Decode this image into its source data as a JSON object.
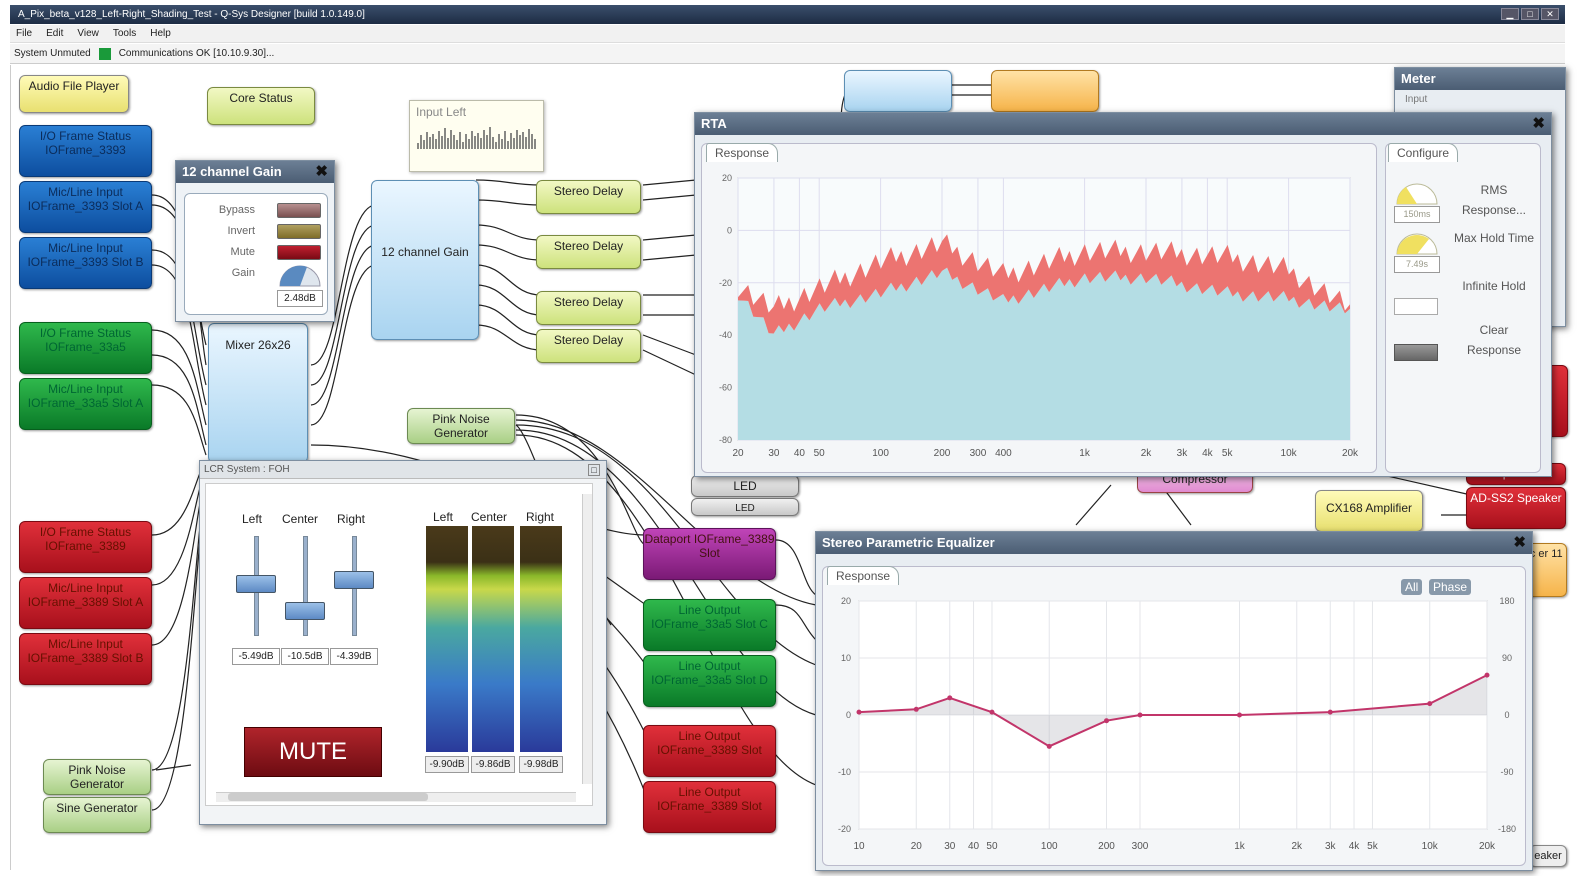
{
  "window": {
    "title": "A_Pix_beta_v128_Left-Right_Shading_Test - Q-Sys Designer [build 1.0.149.0]"
  },
  "menu": [
    "File",
    "Edit",
    "View",
    "Tools",
    "Help"
  ],
  "status": {
    "system": "System Unmuted",
    "comms": "Communications OK [10.10.9.30]..."
  },
  "colors": {
    "comms_ok": "#1a9a3a",
    "rta_red": "#ec7471",
    "rta_blue": "#b4dde4",
    "mute": "#9a1a22"
  },
  "blocks": {
    "audio_file_player": "Audio File Player",
    "core_status": "Core Status",
    "io_frame_status_blue": "I/O Frame Status IOFrame_3393",
    "mic_in_blue_a": "Mic/Line Input IOFrame_3393 Slot A",
    "mic_in_blue_b": "Mic/Line Input IOFrame_3393 Slot B",
    "io_frame_status_green": "I/O Frame Status IOFrame_33a5",
    "mic_in_green_a": "Mic/Line Input IOFrame_33a5 Slot A",
    "io_frame_status_red": "I/O Frame Status IOFrame_3389",
    "mic_in_red_a": "Mic/Line Input IOFrame_3389 Slot A",
    "mic_in_red_b": "Mic/Line Input IOFrame_3389 Slot B",
    "pink_noise_1": "Pink Noise Generator",
    "pink_noise_2": "Pink Noise Generator",
    "sine_gen": "Sine Generator",
    "mixer": "Mixer 26x26",
    "gain12": "12 channel Gain",
    "stereo_delay": "Stereo Delay",
    "dataport": "Dataport IOFrame_3389 Slot",
    "line_out_green_c": "Line Output IOFrame_33a5 Slot C",
    "line_out_green_d": "Line Output IOFrame_33a5 Slot D",
    "line_out_red_a": "Line Output IOFrame_3389 Slot",
    "line_out_red_b": "Line Output IOFrame_3389 Slot",
    "led": "LED",
    "compressor": "Compressor",
    "cx168": "CX168 Amplifier",
    "ad_ss2": "AD-SS2 Speaker",
    "speaker": "Speaker",
    "edge_fragment": "ic er 11",
    "edge_speaker": "eaker"
  },
  "input_left": {
    "title": "Input Left"
  },
  "gain_panel": {
    "title": "12 channel Gain",
    "bypass": "Bypass",
    "invert": "Invert",
    "mute": "Mute",
    "gain": "Gain",
    "gain_value": "2.48dB"
  },
  "rta": {
    "title": "RTA",
    "response_tab": "Response",
    "configure_tab": "Configure",
    "yticks": [
      "20",
      "0",
      "-20",
      "-40",
      "-60",
      "-80"
    ],
    "xticks": [
      "20",
      "30",
      "40",
      "50",
      "100",
      "200",
      "300",
      "400",
      "1k",
      "2k",
      "3k",
      "4k",
      "5k",
      "10k",
      "20k"
    ],
    "config": {
      "rms_value": "150ms",
      "rms_label": "RMS Response...",
      "hold_value": "7.49s",
      "hold_label": "Max Hold Time",
      "infinite": "Infinite Hold",
      "clear": "Clear Response"
    }
  },
  "meter": {
    "title": "Meter",
    "input": "Input"
  },
  "lcr": {
    "title": "LCR System : FOH",
    "fader_labels": [
      "Left",
      "Center",
      "Right"
    ],
    "fader_values": [
      "-5.49dB",
      "-10.5dB",
      "-4.39dB"
    ],
    "fader_levels": [
      0.5,
      0.2,
      0.55
    ],
    "meter_labels": [
      "Left",
      "Center",
      "Right"
    ],
    "meter_values": [
      "-9.90dB",
      "-9.86dB",
      "-9.98dB"
    ],
    "mute": "MUTE"
  },
  "peq": {
    "title": "Stereo Parametric Equalizer",
    "response_tab": "Response",
    "all_btn": "All",
    "phase_btn": "Phase",
    "yticks_left": [
      "20",
      "10",
      "0",
      "-10",
      "-20"
    ],
    "yticks_right": [
      "180",
      "90",
      "0",
      "-90",
      "-180"
    ],
    "xticks": [
      "10",
      "20",
      "30",
      "40",
      "50",
      "100",
      "200",
      "300",
      "1k",
      "2k",
      "3k",
      "4k",
      "5k",
      "10k",
      "20k"
    ]
  },
  "chart_data": [
    {
      "type": "area",
      "title": "",
      "ylim": [
        -80,
        20
      ],
      "xlabel": "",
      "ylabel": "",
      "x_scale": "log",
      "x": [
        20,
        30,
        50,
        100,
        200,
        400,
        1000,
        2000,
        5000,
        10000,
        20000
      ],
      "series": [
        {
          "values": [
            -21,
            -30,
            -22,
            -12,
            -5,
            -17,
            -8,
            -8,
            -10,
            -15,
            -30
          ]
        },
        {
          "values": [
            -24,
            -40,
            -30,
            -24,
            -16,
            -27,
            -18,
            -18,
            -24,
            -26,
            -31
          ]
        }
      ]
    },
    {
      "type": "line",
      "title": "",
      "ylim": [
        -20,
        20
      ],
      "xlabel": "",
      "ylabel": "",
      "x_scale": "log",
      "x": [
        10,
        20,
        30,
        50,
        100,
        200,
        300,
        1000,
        3000,
        10000,
        20000
      ],
      "series": [
        {
          "values": [
            0.5,
            1,
            3,
            0.5,
            -5.5,
            -1,
            0,
            0,
            0.5,
            2,
            7
          ]
        }
      ]
    }
  ]
}
